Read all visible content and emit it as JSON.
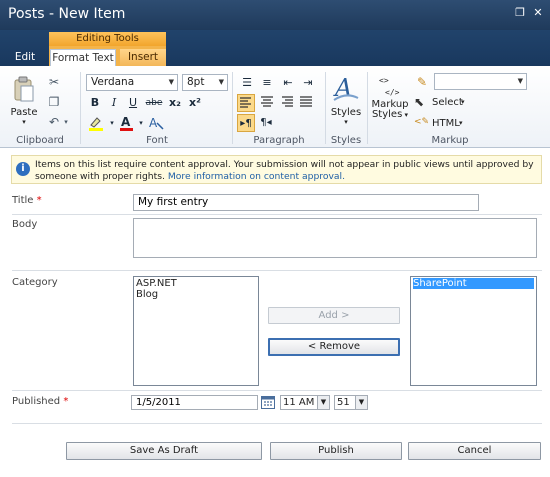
{
  "window": {
    "title": "Posts - New Item",
    "maximize_glyph": "❐",
    "close_glyph": "✕"
  },
  "ribbon": {
    "contextual_header": "Editing Tools",
    "tabs": [
      "Edit",
      "Format Text",
      "Insert"
    ],
    "clipboard": {
      "paste_label": "Paste",
      "group_label": "Clipboard"
    },
    "font": {
      "family": "Verdana",
      "size": "8pt",
      "group_label": "Font",
      "bold": "B",
      "italic": "I",
      "underline": "U",
      "strike": "abe",
      "subscript": "x₂",
      "superscript": "x²"
    },
    "paragraph": {
      "group_label": "Paragraph"
    },
    "styles": {
      "label": "Styles",
      "group_label": "Styles"
    },
    "markup": {
      "markup_styles_label_1": "Markup",
      "markup_styles_label_2": "Styles",
      "select_label": "Select",
      "html_label": "HTML",
      "group_label": "Markup",
      "dropdown_value": ""
    }
  },
  "message": {
    "text": "Items on this list require content approval. Your submission will not appear in public views until approved by someone with proper rights.",
    "link": "More information on content approval."
  },
  "form": {
    "title": {
      "label": "Title",
      "required_mark": "*",
      "value": "My first entry"
    },
    "body": {
      "label": "Body",
      "value": ""
    },
    "category": {
      "label": "Category",
      "available": [
        "ASP.NET",
        "Blog"
      ],
      "selected": [
        "SharePoint"
      ],
      "add_label": "Add >",
      "remove_label": "< Remove"
    },
    "published": {
      "label": "Published",
      "required_mark": "*",
      "date": "1/5/2011",
      "hour": "11 AM",
      "minute": "51"
    }
  },
  "buttons": {
    "save_draft": "Save As Draft",
    "publish": "Publish",
    "cancel": "Cancel"
  },
  "colors": {
    "titlebar": "#1f3a5b",
    "contextual_tab": "#f4b44a",
    "required": "#dd0000",
    "link": "#1f5fa6",
    "selection": "#3399ff"
  }
}
